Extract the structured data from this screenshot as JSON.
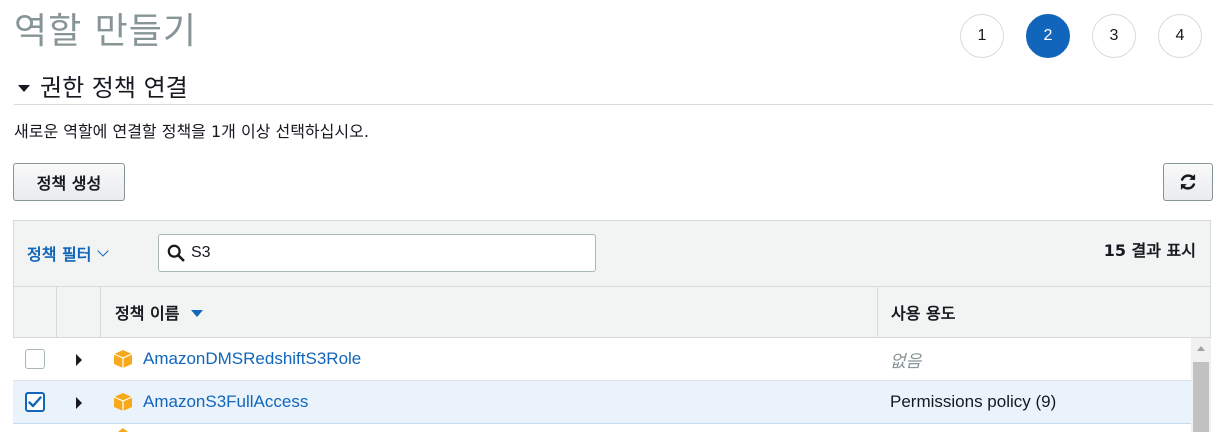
{
  "page": {
    "title": "역할 만들기"
  },
  "steps": [
    "1",
    "2",
    "3",
    "4"
  ],
  "active_step": "2",
  "section": {
    "title": "권한 정책 연결",
    "description": "새로운 역할에 연결할 정책을 1개 이상 선택하십시오."
  },
  "toolbar": {
    "create_label": "정책 생성",
    "refresh_icon": "refresh-icon"
  },
  "filter": {
    "label": "정책 필터",
    "search_value": "S3",
    "result_count": "15 결과 표시"
  },
  "table": {
    "columns": [
      "정책 이름",
      "사용 용도"
    ],
    "rows": [
      {
        "name": "AmazonDMSRedshiftS3Role",
        "usage": "없음",
        "checked": false
      },
      {
        "name": "AmazonS3FullAccess",
        "usage": "Permissions policy (9)",
        "checked": true
      }
    ]
  },
  "colors": {
    "accent": "#1166bb",
    "policy_icon": "#f7a81b",
    "selected_row": "#eaf3fb"
  }
}
